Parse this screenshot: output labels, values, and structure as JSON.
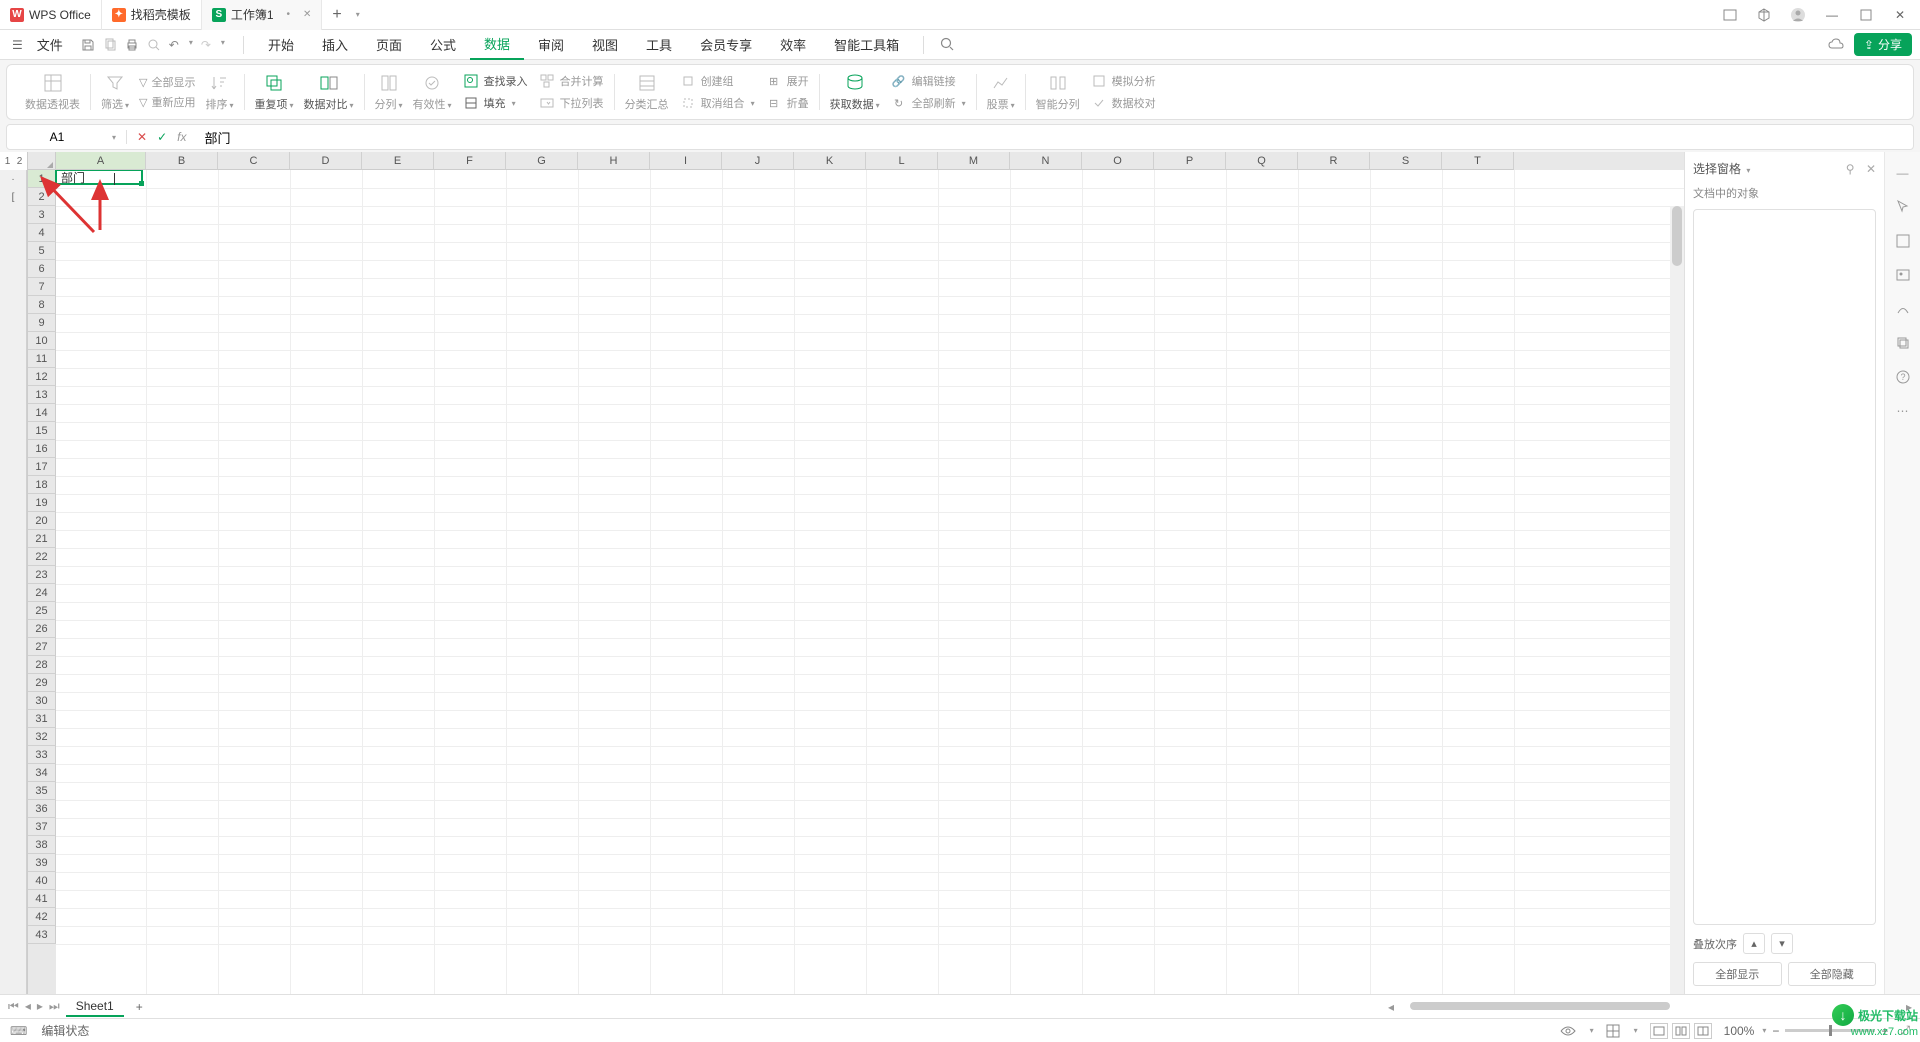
{
  "tabs": {
    "wps": "WPS Office",
    "templates": "找稻壳模板",
    "workbook": "工作簿1"
  },
  "menu": {
    "file": "文件",
    "items": [
      "开始",
      "插入",
      "页面",
      "公式",
      "数据",
      "审阅",
      "视图",
      "工具",
      "会员专享",
      "效率",
      "智能工具箱"
    ],
    "active_index": 4,
    "share": "分享"
  },
  "ribbon": {
    "pivot": "数据透视表",
    "filter": "筛选",
    "show_all": "全部显示",
    "reapply": "重新应用",
    "sort": "排序",
    "duplicates": "重复项",
    "data_compare": "数据对比",
    "split_col": "分列",
    "validation": "有效性",
    "lookup": "查找录入",
    "fill": "填充",
    "consolidate": "合并计算",
    "dropdown_list": "下拉列表",
    "subtotal": "分类汇总",
    "group": "创建组",
    "ungroup": "取消组合",
    "expand": "展开",
    "collapse": "折叠",
    "get_data": "获取数据",
    "edit_links": "编辑链接",
    "refresh_all": "全部刷新",
    "stocks": "股票",
    "smart_split": "智能分列",
    "simulate": "模拟分析",
    "data_check": "数据校对"
  },
  "formula_bar": {
    "name_box": "A1",
    "content": "部门"
  },
  "grid": {
    "outline_levels": [
      "1",
      "2"
    ],
    "columns": [
      "A",
      "B",
      "C",
      "D",
      "E",
      "F",
      "G",
      "H",
      "I",
      "J",
      "K",
      "L",
      "M",
      "N",
      "O",
      "P",
      "Q",
      "R",
      "S",
      "T"
    ],
    "row_count": 43,
    "active_cell_value": "部门"
  },
  "right_panel": {
    "title": "选择窗格",
    "subtitle": "文档中的对象",
    "stack_order": "叠放次序",
    "show_all": "全部显示",
    "hide_all": "全部隐藏"
  },
  "sheet": {
    "name": "Sheet1"
  },
  "status": {
    "mode": "编辑状态",
    "zoom": "100%"
  },
  "watermark": {
    "name": "极光下载站",
    "url": "www.xz7.com"
  }
}
